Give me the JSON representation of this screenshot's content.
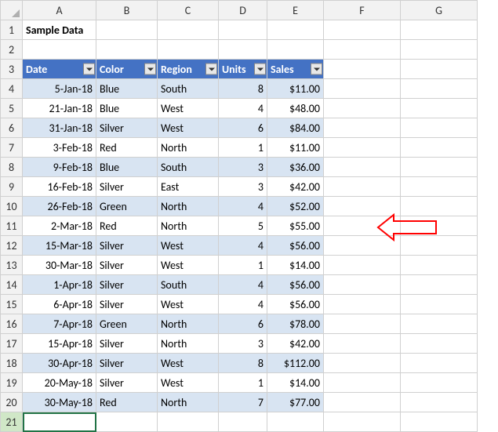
{
  "columns": [
    "A",
    "B",
    "C",
    "D",
    "E",
    "F",
    "G"
  ],
  "title": "Sample Data",
  "headers": {
    "date": "Date",
    "color": "Color",
    "region": "Region",
    "units": "Units",
    "sales": "Sales"
  },
  "rows": [
    {
      "date": "5-Jan-18",
      "color": "Blue",
      "region": "South",
      "units": "8",
      "sales": "$11.00"
    },
    {
      "date": "21-Jan-18",
      "color": "Blue",
      "region": "West",
      "units": "4",
      "sales": "$48.00"
    },
    {
      "date": "31-Jan-18",
      "color": "Silver",
      "region": "West",
      "units": "6",
      "sales": "$84.00"
    },
    {
      "date": "3-Feb-18",
      "color": "Red",
      "region": "North",
      "units": "1",
      "sales": "$11.00"
    },
    {
      "date": "9-Feb-18",
      "color": "Blue",
      "region": "South",
      "units": "3",
      "sales": "$36.00"
    },
    {
      "date": "16-Feb-18",
      "color": "Silver",
      "region": "East",
      "units": "3",
      "sales": "$42.00"
    },
    {
      "date": "26-Feb-18",
      "color": "Green",
      "region": "North",
      "units": "4",
      "sales": "$52.00"
    },
    {
      "date": "2-Mar-18",
      "color": "Red",
      "region": "North",
      "units": "5",
      "sales": "$55.00"
    },
    {
      "date": "15-Mar-18",
      "color": "Silver",
      "region": "West",
      "units": "4",
      "sales": "$56.00"
    },
    {
      "date": "30-Mar-18",
      "color": "Silver",
      "region": "West",
      "units": "1",
      "sales": "$14.00"
    },
    {
      "date": "1-Apr-18",
      "color": "Silver",
      "region": "South",
      "units": "4",
      "sales": "$56.00"
    },
    {
      "date": "6-Apr-18",
      "color": "Silver",
      "region": "West",
      "units": "4",
      "sales": "$56.00"
    },
    {
      "date": "7-Apr-18",
      "color": "Green",
      "region": "North",
      "units": "6",
      "sales": "$78.00"
    },
    {
      "date": "15-Apr-18",
      "color": "Silver",
      "region": "North",
      "units": "3",
      "sales": "$42.00"
    },
    {
      "date": "30-Apr-18",
      "color": "Silver",
      "region": "West",
      "units": "8",
      "sales": "$112.00"
    },
    {
      "date": "20-May-18",
      "color": "Silver",
      "region": "West",
      "units": "1",
      "sales": "$14.00"
    },
    {
      "date": "30-May-18",
      "color": "Red",
      "region": "North",
      "units": "7",
      "sales": "$77.00"
    }
  ],
  "active_row": 21
}
